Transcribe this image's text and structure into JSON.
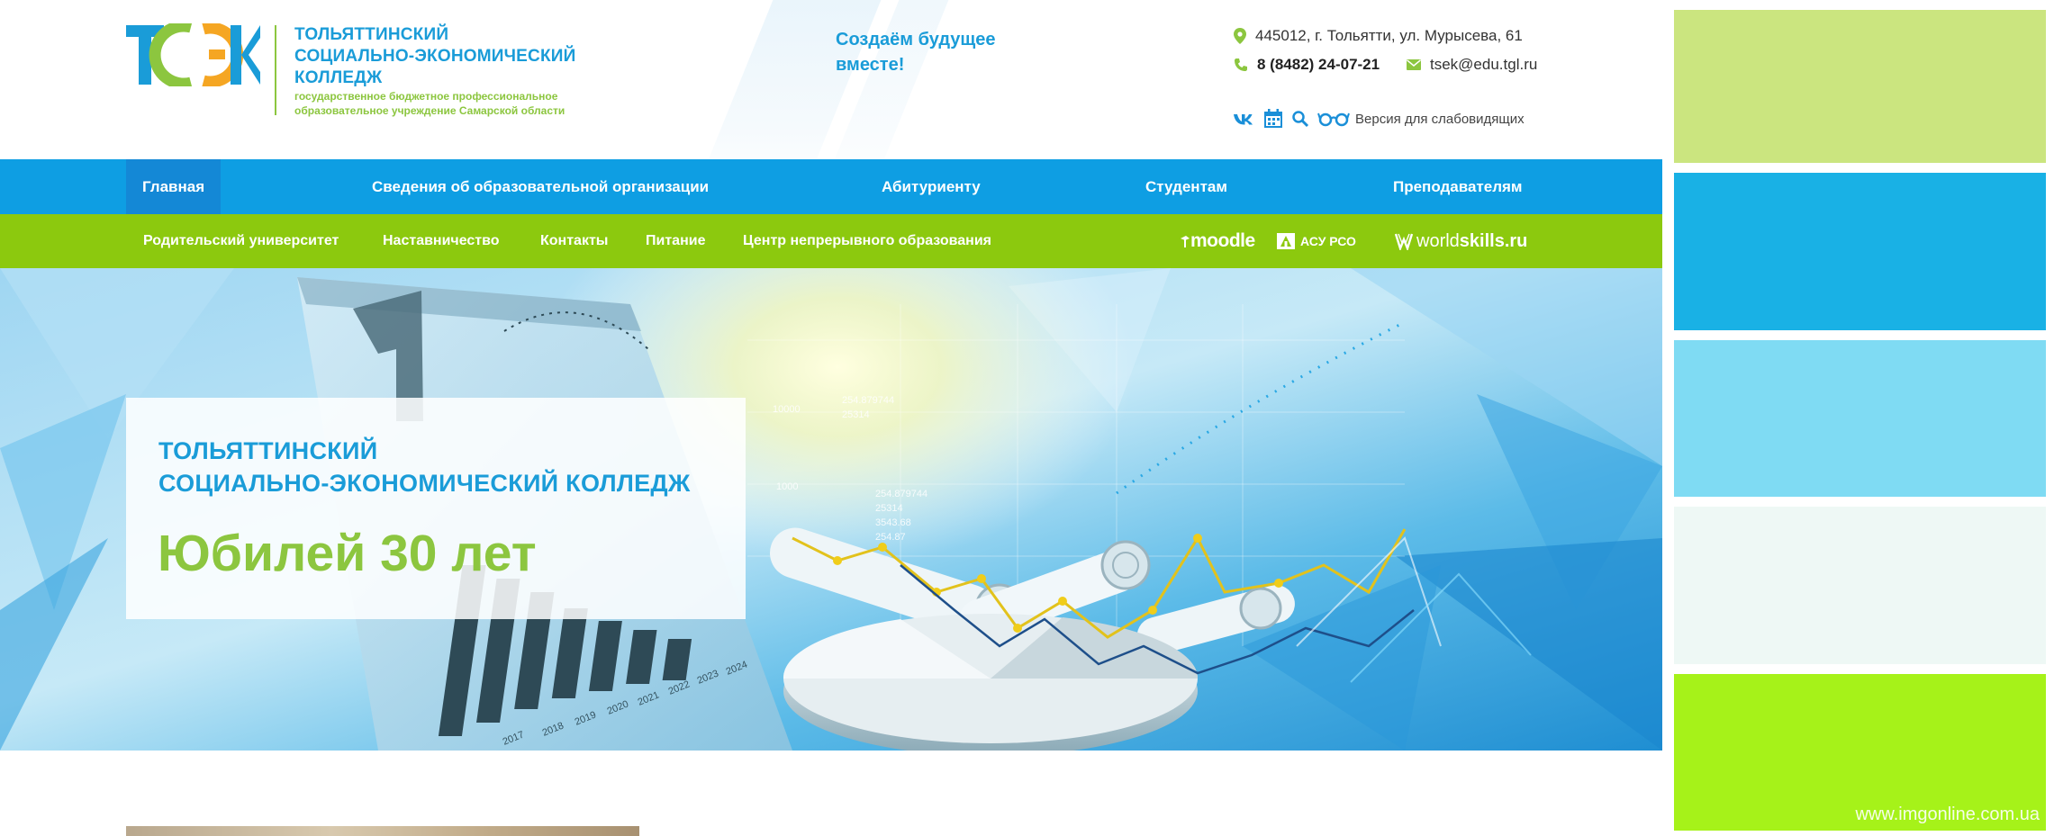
{
  "header": {
    "logo_title_lines": [
      "ТОЛЬЯТТИНСКИЙ",
      "СОЦИАЛЬНО-ЭКОНОМИЧЕСКИЙ",
      "КОЛЛЕДЖ"
    ],
    "logo_sub_lines": [
      "государственное бюджетное профессиональное",
      "образовательное учреждение Самарской области"
    ],
    "logo_mark_text": "ТСЭК",
    "slogan_lines": [
      "Создаём будущее",
      "вместе!"
    ],
    "address": "445012, г. Тольятти, ул. Мурысева, 61",
    "phone": "8 (8482) 24-07-21",
    "email": "tsek@edu.tgl.ru",
    "tools": {
      "vk_icon": "vk-icon",
      "calendar_icon": "calendar-icon",
      "search_icon": "search-icon",
      "glasses_icon": "glasses-icon",
      "accessibility_label": "Версия для слабовидящих"
    }
  },
  "nav_main": {
    "items": [
      {
        "label": "Главная",
        "active": true
      },
      {
        "label": "Сведения об образовательной организации"
      },
      {
        "label": "Абитуриенту"
      },
      {
        "label": "Студентам"
      },
      {
        "label": "Преподавателям"
      }
    ]
  },
  "nav_sub": {
    "items": [
      {
        "label": "Родительский университет"
      },
      {
        "label": "Наставничество"
      },
      {
        "label": "Контакты"
      },
      {
        "label": "Питание"
      },
      {
        "label": "Центр непрерывного образования"
      }
    ],
    "logos": {
      "moodle": "moodle",
      "asu": "АСУ РСО",
      "worldskills_bold": "world",
      "worldskills_rest": "skills.ru"
    }
  },
  "hero": {
    "title_lines": [
      "ТОЛЬЯТТИНСКИЙ",
      "СОЦИАЛЬНО-ЭКОНОМИЧЕСКИЙ КОЛЛЕДЖ"
    ],
    "headline": "Юбилей 30 лет",
    "chart_numbers": [
      "10000",
      "1000",
      "254.879744",
      "25314",
      "3543.68",
      "254.87",
      "2018",
      "2019",
      "2020",
      "2021",
      "2022",
      "2023",
      "2024",
      "2017"
    ]
  },
  "palette": {
    "swatches": [
      "#cbe57f",
      "#19b1e5",
      "#7fdbf3",
      "#eef8f5",
      "#a6f219"
    ],
    "watermark": "www.imgonline.com.ua"
  },
  "colors": {
    "brand_blue": "#1a9cd8",
    "brand_green": "#8cc63f",
    "nav_blue": "#0e9ee3",
    "nav_green": "#8cc90e"
  }
}
